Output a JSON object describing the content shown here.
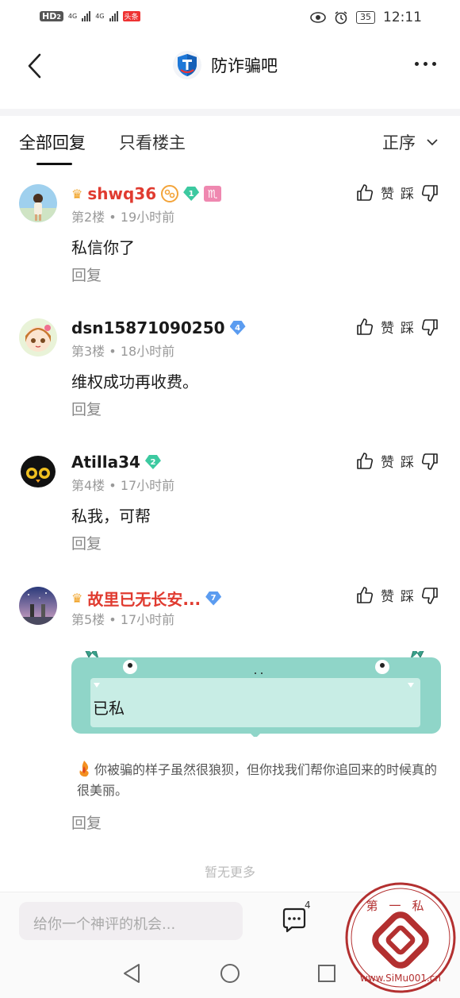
{
  "status_bar": {
    "hd_label": "HD",
    "hd_sub": "2",
    "net1": "4G",
    "net2": "4G",
    "toutiao_badge": "头条",
    "battery": "35",
    "time": "12:11"
  },
  "header": {
    "title": "防诈骗吧"
  },
  "tabs": {
    "all_replies": "全部回复",
    "owner_only": "只看楼主",
    "order": "正序"
  },
  "comments": [
    {
      "username": "shwq36",
      "level": "1",
      "floor": "第2楼",
      "time": "19小时前",
      "content": "私信你了",
      "reply": "回复",
      "like": "赞",
      "dislike": "踩"
    },
    {
      "username": "dsn15871090250",
      "level": "4",
      "floor": "第3楼",
      "time": "18小时前",
      "content": "维权成功再收费。",
      "reply": "回复",
      "like": "赞",
      "dislike": "踩"
    },
    {
      "username": "Atilla34",
      "level": "2",
      "floor": "第4楼",
      "time": "17小时前",
      "content": "私我，可帮",
      "reply": "回复",
      "like": "赞",
      "dislike": "踩"
    },
    {
      "username": "故里已无长安...",
      "level": "7",
      "floor": "第5楼",
      "time": "17小时前",
      "content": "已私",
      "quote": "你被骗的样子虽然很狼狈，但你找我们帮你追回来的时候真的很美丽。",
      "reply": "回复",
      "like": "赞",
      "dislike": "踩"
    }
  ],
  "separator": "•",
  "no_more": "暂无更多",
  "bottom": {
    "input_placeholder": "给你一个神评的机会...",
    "comment_count": "4"
  },
  "watermark": {
    "top_text": "第一私",
    "bottom_text": "www.SiMu001.cn"
  },
  "colors": {
    "accent_red": "#e03b30",
    "bubble_teal": "#8fd5c8",
    "level_green": "#3cc9a0",
    "level_blue": "#5b9cf0",
    "watermark_red": "#b33030"
  }
}
